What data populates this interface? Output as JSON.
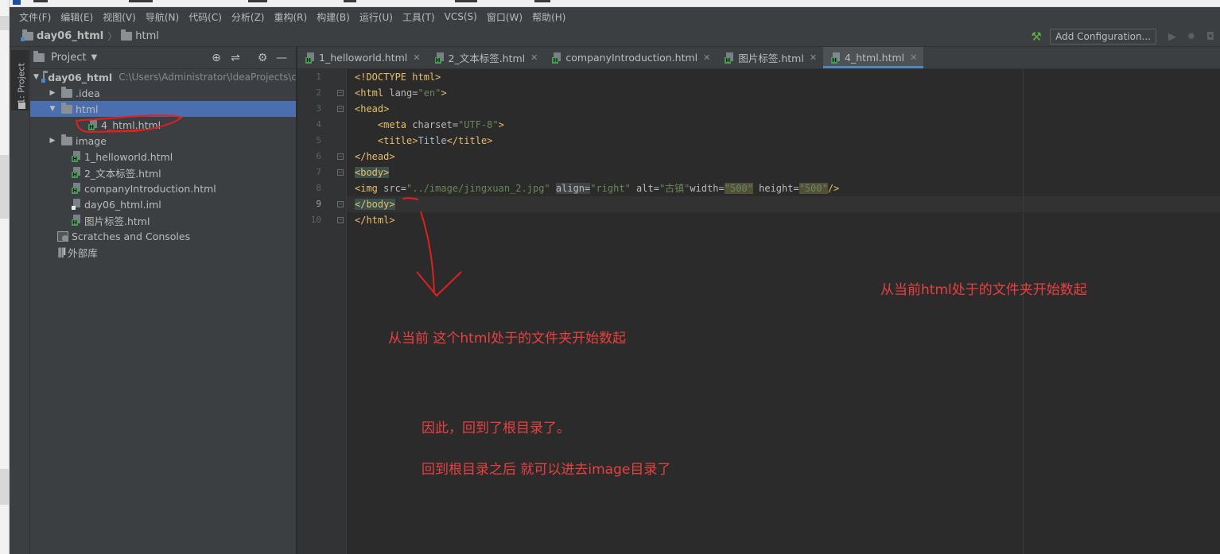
{
  "menu": [
    "文件(F)",
    "编辑(E)",
    "视图(V)",
    "导航(N)",
    "代码(C)",
    "分析(Z)",
    "重构(R)",
    "构建(B)",
    "运行(U)",
    "工具(T)",
    "VCS(S)",
    "窗口(W)",
    "帮助(H)"
  ],
  "breadcrumb": {
    "project": "day06_html",
    "folder": "html"
  },
  "toolbar": {
    "add_config": "Add Configuration..."
  },
  "tool_window": {
    "label": "1: Project"
  },
  "project_panel": {
    "title": "Project",
    "root": {
      "name": "day06_html",
      "path": "C:\\Users\\Administrator\\IdeaProjects\\c"
    },
    "items": {
      "idea": ".idea",
      "html": "html",
      "html_file": "4_html.html",
      "image": "image",
      "f1": "1_helloworld.html",
      "f2": "2_文本标签.html",
      "f3": "companyIntroduction.html",
      "f4": "day06_html.iml",
      "f5": "图片标签.html",
      "scratches": "Scratches and Consoles",
      "libs": "外部库"
    }
  },
  "tabs": [
    "1_helloworld.html",
    "2_文本标签.html",
    "companyIntroduction.html",
    "图片标签.html",
    "4_html.html"
  ],
  "active_tab": "4_html.html",
  "code": {
    "l1a": "<!DOCTYPE",
    "l1b": " html>",
    "l2a": "<html ",
    "l2b": "lang=",
    "l2c": "\"en\"",
    "l2d": ">",
    "l3": "<head>",
    "l4a": "    <meta ",
    "l4b": "charset=",
    "l4c": "\"UTF-8\"",
    "l4d": ">",
    "l5a": "    <title>",
    "l5b": "Title",
    "l5c": "</title>",
    "l6": "</head>",
    "l7": "<body>",
    "l8a": "<img ",
    "l8b": "src=",
    "l8c": "\"../image/jingxuan_2.jpg\"",
    "l8d": " ",
    "l8e": "align=",
    "l8f": "\"right\"",
    "l8g": " alt=",
    "l8h": "\"古镇\"",
    "l8i": "width=",
    "l8j": "\"500\"",
    "l8k": " height=",
    "l8l": "\"500\"",
    "l8m": "/>",
    "l9": "</body>",
    "l10": "</html>"
  },
  "annotations": {
    "a1": "从当前html处于的文件夹开始数起",
    "a2": "从当前 这个html处于的文件夹开始数起",
    "a3": "因此，回到了根目录了。",
    "a4": "回到根目录之后  就可以进去image目录了"
  },
  "colors": {
    "annotation": "#e84040",
    "selection": "#4b6eaf",
    "tag": "#e8bf6a",
    "string": "#6a8759"
  }
}
